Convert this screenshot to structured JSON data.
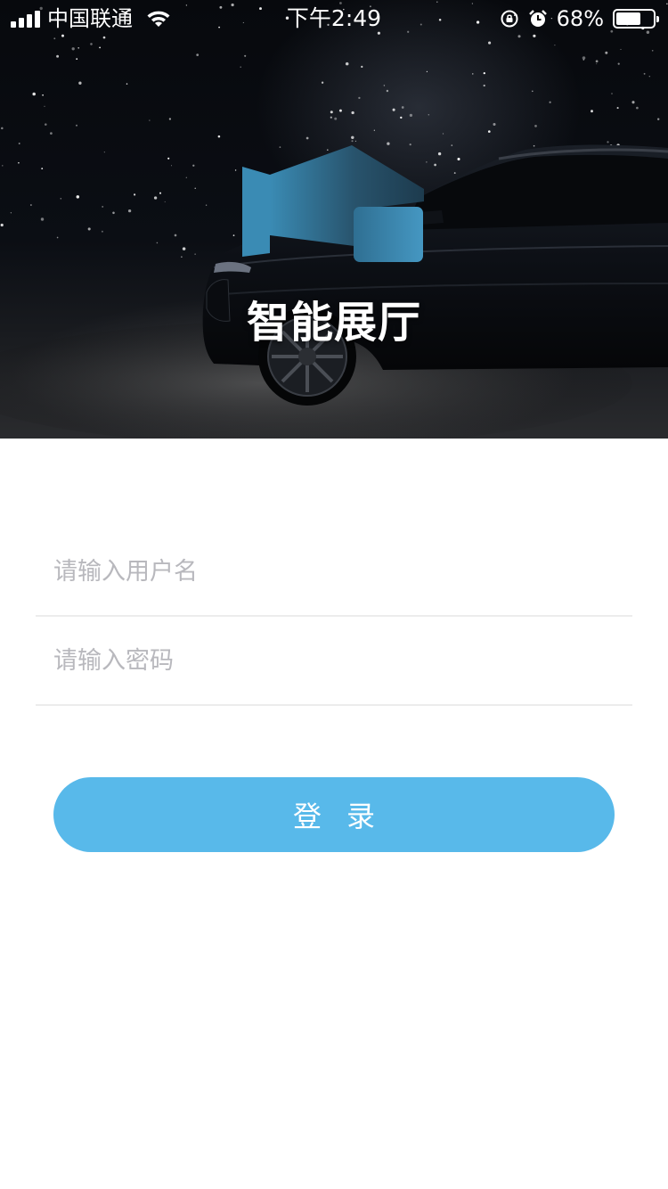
{
  "status_bar": {
    "carrier": "中国联通",
    "time": "下午2:49",
    "battery_percent": "68%",
    "battery_level": 0.68,
    "icons": [
      "signal-icon",
      "wifi-icon",
      "orientation-lock-icon",
      "alarm-icon",
      "battery-icon"
    ]
  },
  "hero": {
    "title": "智能展厅",
    "logo_icon": "showroom-logo-icon",
    "colors": {
      "logo_dark": "#2d6f8e",
      "logo_light": "#3f8fb8"
    }
  },
  "form": {
    "username_placeholder": "请输入用户名",
    "password_placeholder": "请输入密码",
    "login_label": "登录"
  },
  "colors": {
    "accent": "#58b9ea",
    "placeholder": "#b8b8bd",
    "divider": "#ececec"
  }
}
